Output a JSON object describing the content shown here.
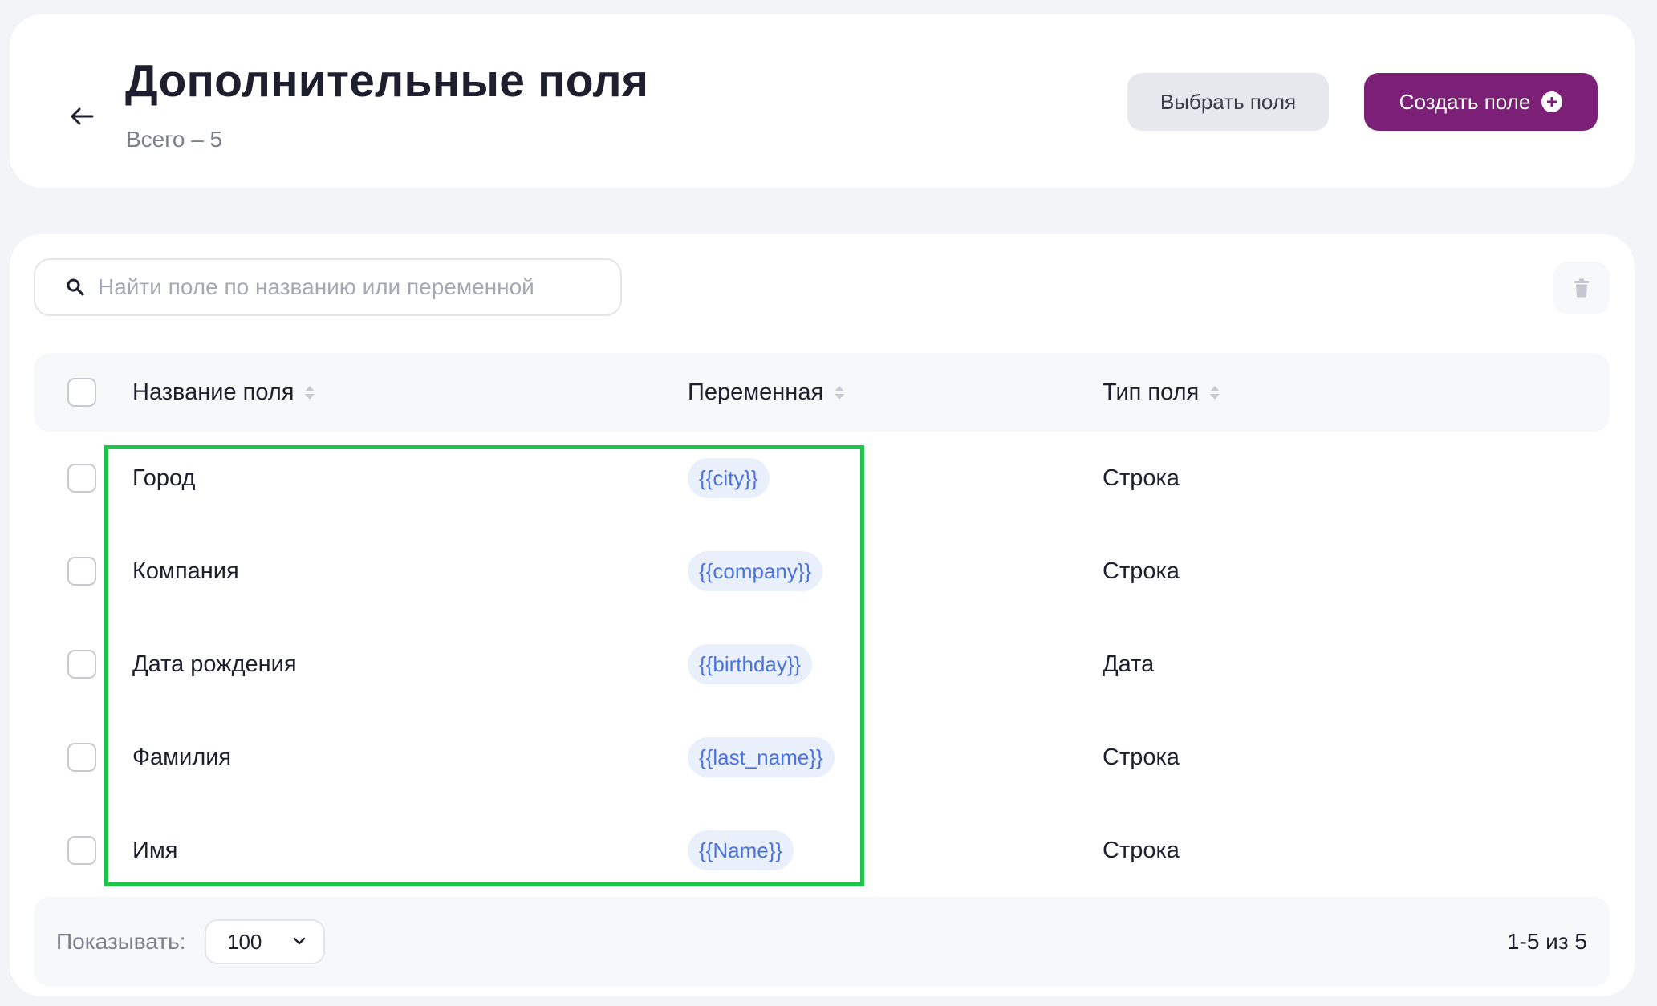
{
  "header": {
    "title": "Дополнительные поля",
    "subtitle": "Всего – 5",
    "back_icon": "arrow-left-icon",
    "select_fields_label": "Выбрать поля",
    "create_field_label": "Создать поле",
    "accent_color": "#7b2076"
  },
  "search": {
    "placeholder": "Найти поле по названию или переменной",
    "value": ""
  },
  "table": {
    "columns": [
      {
        "label": "Название поля"
      },
      {
        "label": "Переменная"
      },
      {
        "label": "Тип поля"
      }
    ],
    "rows": [
      {
        "name": "Город",
        "variable": "{{city}}",
        "type": "Строка"
      },
      {
        "name": "Компания",
        "variable": "{{company}}",
        "type": "Строка"
      },
      {
        "name": "Дата рождения",
        "variable": "{{birthday}}",
        "type": "Дата"
      },
      {
        "name": "Фамилия",
        "variable": "{{last_name}}",
        "type": "Строка"
      },
      {
        "name": "Имя",
        "variable": "{{Name}}",
        "type": "Строка"
      }
    ]
  },
  "footer": {
    "per_page_label": "Показывать:",
    "per_page_value": "100",
    "range_info": "1-5 из 5"
  },
  "colors": {
    "highlight_border": "#1fc34a",
    "variable_chip_bg": "#eaeffc",
    "variable_chip_text": "#4a73dd"
  }
}
